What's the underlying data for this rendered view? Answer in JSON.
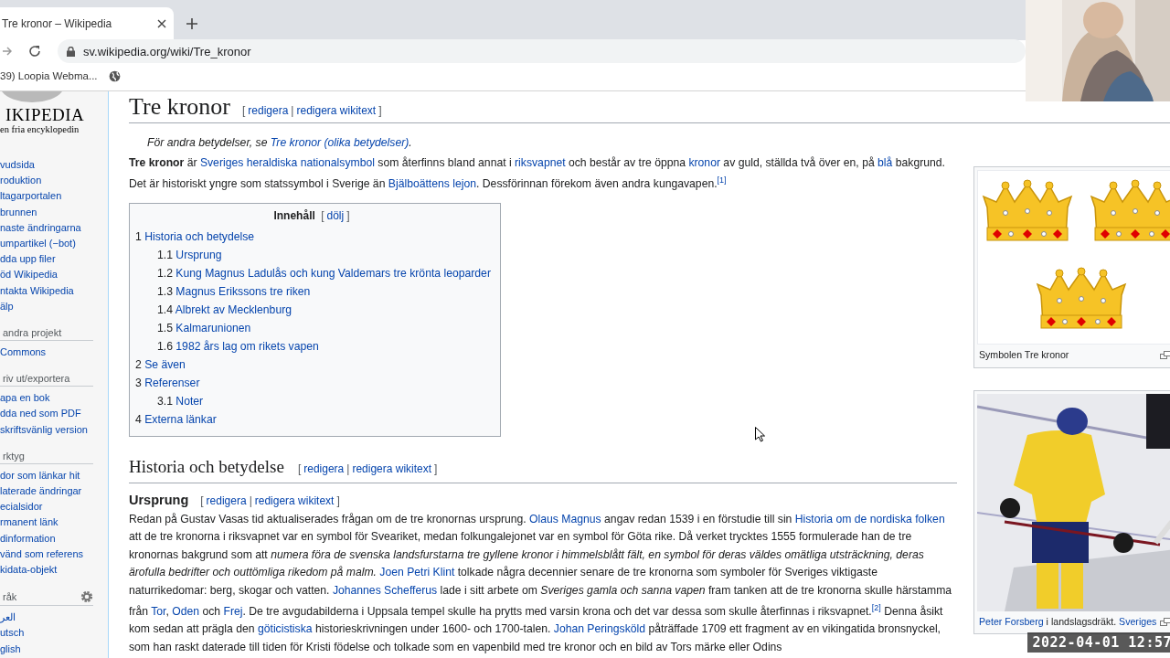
{
  "browser": {
    "tab_title": "Tre kronor – Wikipedia",
    "url": "sv.wikipedia.org/wiki/Tre_kronor",
    "bookmarks": [
      {
        "label": "39) Loopia Webma..."
      }
    ]
  },
  "sidebar": {
    "logo_name": "IKIPEDIA",
    "tagline": "en fria encyklopedin",
    "sections": [
      {
        "items": [
          "vudsida",
          "roduktion",
          "ltagarportalen",
          "brunnen",
          "naste ändringarna",
          "umpartikel (−bot)",
          "dda upp filer",
          "öd Wikipedia",
          "ntakta Wikipedia",
          "älp"
        ]
      },
      {
        "heading": "andra projekt",
        "items": [
          "Commons"
        ]
      },
      {
        "heading": "riv ut/exportera",
        "items": [
          "apa en bok",
          "dda ned som PDF",
          "skriftsvänlig version"
        ]
      },
      {
        "heading": "rktyg",
        "items": [
          "dor som länkar hit",
          "laterade ändringar",
          "ecialsidor",
          "rmanent länk",
          "dinformation",
          "vänd som referens",
          "kidata-objekt"
        ]
      },
      {
        "heading": "råk",
        "settings": true,
        "items": [
          "العر",
          "utsch",
          "glish"
        ]
      }
    ]
  },
  "article": {
    "title": "Tre kronor",
    "edit_links": [
      {
        "kind": "punct",
        "text": "["
      },
      {
        "kind": "link",
        "text": "redigera"
      },
      {
        "kind": "punct",
        "text": "|"
      },
      {
        "kind": "link",
        "text": "redigera wikitext"
      },
      {
        "kind": "punct",
        "text": "]"
      }
    ],
    "hatnote": [
      {
        "kind": "text",
        "text": "För andra betydelser, se "
      },
      {
        "kind": "link",
        "text": "Tre kronor (olika betydelser)"
      },
      {
        "kind": "text",
        "text": "."
      }
    ],
    "intro": [
      {
        "kind": "bold",
        "text": "Tre kronor"
      },
      {
        "kind": "text",
        "text": " är "
      },
      {
        "kind": "link",
        "text": "Sveriges heraldiska nationalsymbol"
      },
      {
        "kind": "text",
        "text": " som återfinns bland annat i "
      },
      {
        "kind": "link",
        "text": "riksvapnet"
      },
      {
        "kind": "text",
        "text": " och består av tre öppna "
      },
      {
        "kind": "link",
        "text": "kronor"
      },
      {
        "kind": "text",
        "text": " av guld, ställda två över en, på "
      },
      {
        "kind": "link",
        "text": "blå"
      },
      {
        "kind": "text",
        "text": " bakgrund. Det är historiskt yngre som statssymbol i Sverige än "
      },
      {
        "kind": "link",
        "text": "Bjälboättens lejon"
      },
      {
        "kind": "text",
        "text": ". Dessförinnan förekom även andra kungavapen."
      },
      {
        "kind": "ref",
        "text": "[1]"
      }
    ],
    "toc": {
      "title": "Innehåll",
      "toggle": [
        {
          "kind": "punct",
          "text": "["
        },
        {
          "kind": "link",
          "text": "dölj"
        },
        {
          "kind": "punct",
          "text": "]"
        }
      ],
      "items": [
        {
          "number": "1",
          "label": "Historia och betydelse",
          "children": [
            {
              "number": "1.1",
              "label": "Ursprung"
            },
            {
              "number": "1.2",
              "label": "Kung Magnus Ladulås och kung Valdemars tre krönta leoparder"
            },
            {
              "number": "1.3",
              "label": "Magnus Erikssons tre riken"
            },
            {
              "number": "1.4",
              "label": "Albrekt av Mecklenburg"
            },
            {
              "number": "1.5",
              "label": "Kalmarunionen"
            },
            {
              "number": "1.6",
              "label": "1982 års lag om rikets vapen"
            }
          ]
        },
        {
          "number": "2",
          "label": "Se även"
        },
        {
          "number": "3",
          "label": "Referenser",
          "children": [
            {
              "number": "3.1",
              "label": "Noter"
            }
          ]
        },
        {
          "number": "4",
          "label": "Externa länkar"
        }
      ]
    },
    "sections": [
      {
        "kind": "heading",
        "title": "Historia och betydelse",
        "edit_links": [
          {
            "kind": "punct",
            "text": "["
          },
          {
            "kind": "link",
            "text": "redigera"
          },
          {
            "kind": "punct",
            "text": "|"
          },
          {
            "kind": "link",
            "text": "redigera wikitext"
          },
          {
            "kind": "punct",
            "text": "]"
          }
        ]
      },
      {
        "kind": "subheading",
        "title": "Ursprung",
        "edit_links": [
          {
            "kind": "punct",
            "text": "["
          },
          {
            "kind": "link",
            "text": "redigera"
          },
          {
            "kind": "punct",
            "text": "|"
          },
          {
            "kind": "link",
            "text": "redigera wikitext"
          },
          {
            "kind": "punct",
            "text": "]"
          }
        ],
        "paragraph": [
          {
            "kind": "text",
            "text": "Redan på Gustav Vasas tid aktualiserades frågan om de tre kronornas ursprung. "
          },
          {
            "kind": "link",
            "text": "Olaus Magnus"
          },
          {
            "kind": "text",
            "text": " angav redan 1539 i en förstudie till sin "
          },
          {
            "kind": "link",
            "text": "Historia om de nordiska folken"
          },
          {
            "kind": "text",
            "text": " att de tre kronorna i riksvapnet var en symbol för Sveariket, medan folkungalejonet var en symbol för Göta rike. Då verket trycktes 1555 formulerade han de tre kronornas bakgrund som att "
          },
          {
            "kind": "italic",
            "text": "numera föra de svenska landsfurstarna tre gyllene kronor i himmelsblått fält, en symbol för deras väldes omätliga utsträckning, deras ärofulla bedrifter och outtömliga rikedom på malm. "
          },
          {
            "kind": "link",
            "text": "Joen Petri Klint"
          },
          {
            "kind": "text",
            "text": " tolkade några decennier senare de tre kronorna som symboler för Sveriges viktigaste naturrikedomar: berg, skogar och vatten. "
          },
          {
            "kind": "link",
            "text": "Johannes Schefferus"
          },
          {
            "kind": "text",
            "text": " lade i sitt arbete om "
          },
          {
            "kind": "italic",
            "text": "Sveriges gamla och sanna vapen"
          },
          {
            "kind": "text",
            "text": " fram tanken att de tre kronorna skulle härstamma från "
          },
          {
            "kind": "link",
            "text": "Tor"
          },
          {
            "kind": "text",
            "text": ", "
          },
          {
            "kind": "link",
            "text": "Oden"
          },
          {
            "kind": "text",
            "text": " och "
          },
          {
            "kind": "link",
            "text": "Frej"
          },
          {
            "kind": "text",
            "text": ". De tre avgudabilderna i Uppsala tempel skulle ha prytts med varsin krona och det var dessa som skulle återfinnas i riksvapnet."
          },
          {
            "kind": "ref",
            "text": "[2]"
          },
          {
            "kind": "text",
            "text": " Denna åsikt kom sedan att prägla den "
          },
          {
            "kind": "link",
            "text": "göticistiska"
          },
          {
            "kind": "text",
            "text": " historieskrivningen under 1600- och 1700-talen. "
          },
          {
            "kind": "link",
            "text": "Johan Peringsköld"
          },
          {
            "kind": "text",
            "text": " påträffade 1709 ett fragment av en vikingatida bronsnyckel, som han raskt daterade till tiden för Kristi födelse och tolkade som en vapenbild med tre kronor och en bild av Tors märke eller Odins"
          }
        ]
      }
    ],
    "figures": [
      {
        "kind": "crowns",
        "caption": [
          {
            "kind": "text",
            "text": "Symbolen Tre kronor"
          }
        ]
      },
      {
        "kind": "picture",
        "caption": [
          {
            "kind": "link",
            "text": "Peter Forsberg"
          },
          {
            "kind": "text",
            "text": " i landslagsdräkt. "
          },
          {
            "kind": "link",
            "text": "Sveriges"
          }
        ]
      }
    ]
  },
  "overlay": {
    "timestamp": "2022-04-01 12:57"
  }
}
